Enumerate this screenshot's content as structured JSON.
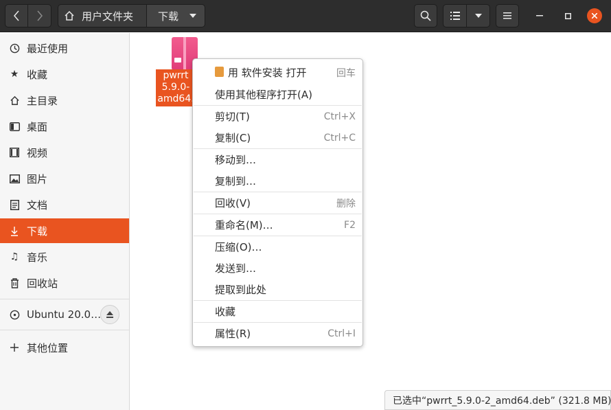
{
  "header": {
    "path_home": "用户文件夹",
    "path_current": "下载"
  },
  "sidebar": {
    "items": [
      {
        "label": "最近使用",
        "icon": "clock-icon"
      },
      {
        "label": "收藏",
        "icon": "star-icon"
      },
      {
        "label": "主目录",
        "icon": "home-icon"
      },
      {
        "label": "桌面",
        "icon": "desktop-icon"
      },
      {
        "label": "视频",
        "icon": "video-icon"
      },
      {
        "label": "图片",
        "icon": "image-icon"
      },
      {
        "label": "文档",
        "icon": "document-icon"
      },
      {
        "label": "下载",
        "icon": "download-icon"
      },
      {
        "label": "音乐",
        "icon": "music-icon"
      },
      {
        "label": "回收站",
        "icon": "trash-icon"
      }
    ],
    "device": "Ubuntu 20.0…",
    "other_locations": "其他位置"
  },
  "file": {
    "name_visible": "pwrrt\n5.9.0-\namd64."
  },
  "context_menu": {
    "open_with_app": "用 软件安装 打开",
    "open_with_app_accel": "回车",
    "open_with_other": "使用其他程序打开(A)",
    "cut": "剪切(T)",
    "cut_accel": "Ctrl+X",
    "copy": "复制(C)",
    "copy_accel": "Ctrl+C",
    "move_to": "移动到…",
    "copy_to": "复制到…",
    "trash": "回收(V)",
    "trash_accel": "删除",
    "rename": "重命名(M)…",
    "rename_accel": "F2",
    "compress": "压缩(O)…",
    "send_to": "发送到…",
    "extract_here": "提取到此处",
    "star": "收藏",
    "properties": "属性(R)",
    "properties_accel": "Ctrl+I"
  },
  "status": {
    "text": "已选中“pwrrt_5.9.0-2_amd64.deb” (321.8 MB)"
  },
  "colors": {
    "accent": "#e95420",
    "headerbar": "#2d2d2d",
    "file_icon": "#e03d79"
  }
}
